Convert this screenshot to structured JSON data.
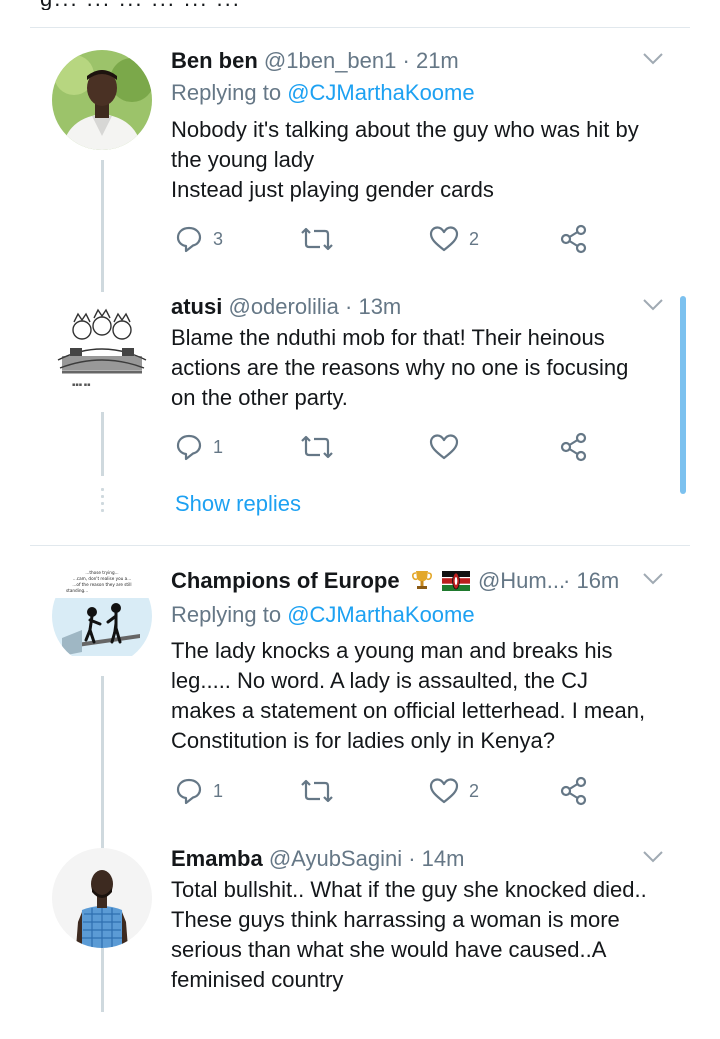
{
  "tweets": [
    {
      "name": "Ben ben",
      "handle": "@1ben_ben1",
      "time": "21m",
      "replying_prefix": "Replying to",
      "replying_to": "@CJMarthaKoome",
      "text": "Nobody it's talking about the guy who was hit by\nthe young lady\nInstead just playing gender cards",
      "replies": "3",
      "retweets": "",
      "likes": "2"
    },
    {
      "name": "atusi",
      "handle": "@oderolilia",
      "time": "13m",
      "text": "Blame the nduthi mob for that! Their heinous\nactions are the reasons why no one is focusing\non the other party.",
      "replies": "1",
      "retweets": "",
      "likes": "",
      "show_replies": "Show replies"
    },
    {
      "name": "Champions of Europe",
      "handle": "@Hum...",
      "time": "16m",
      "replying_prefix": "Replying to",
      "replying_to": "@CJMarthaKoome",
      "text": "The lady knocks a young man and breaks his\nleg..... No word. A lady is assaulted, the CJ\nmakes a statement on official letterhead. I mean,\nConstitution is for ladies only in Kenya?",
      "replies": "1",
      "retweets": "",
      "likes": "2",
      "avatar_caption": "...those trying... ...cam, don't realise you a... ...of the reason they are still standing..."
    },
    {
      "name": "Emamba",
      "handle": "@AyubSagini",
      "time": "14m",
      "text": "Total bullshit.. What if the guy she knocked died..\nThese guys think harrassing a woman is more\nserious than what she would have caused..A\nfeminised country"
    }
  ],
  "colors": {
    "accent": "#1da1f2",
    "meta": "#657786",
    "text": "#14171a",
    "thread_line": "#cfd9de",
    "divider": "#e1e8ed"
  },
  "icons": [
    "reply-icon",
    "retweet-icon",
    "like-icon",
    "share-icon",
    "chevron-down-icon",
    "trophy-icon",
    "kenya-flag-icon"
  ]
}
